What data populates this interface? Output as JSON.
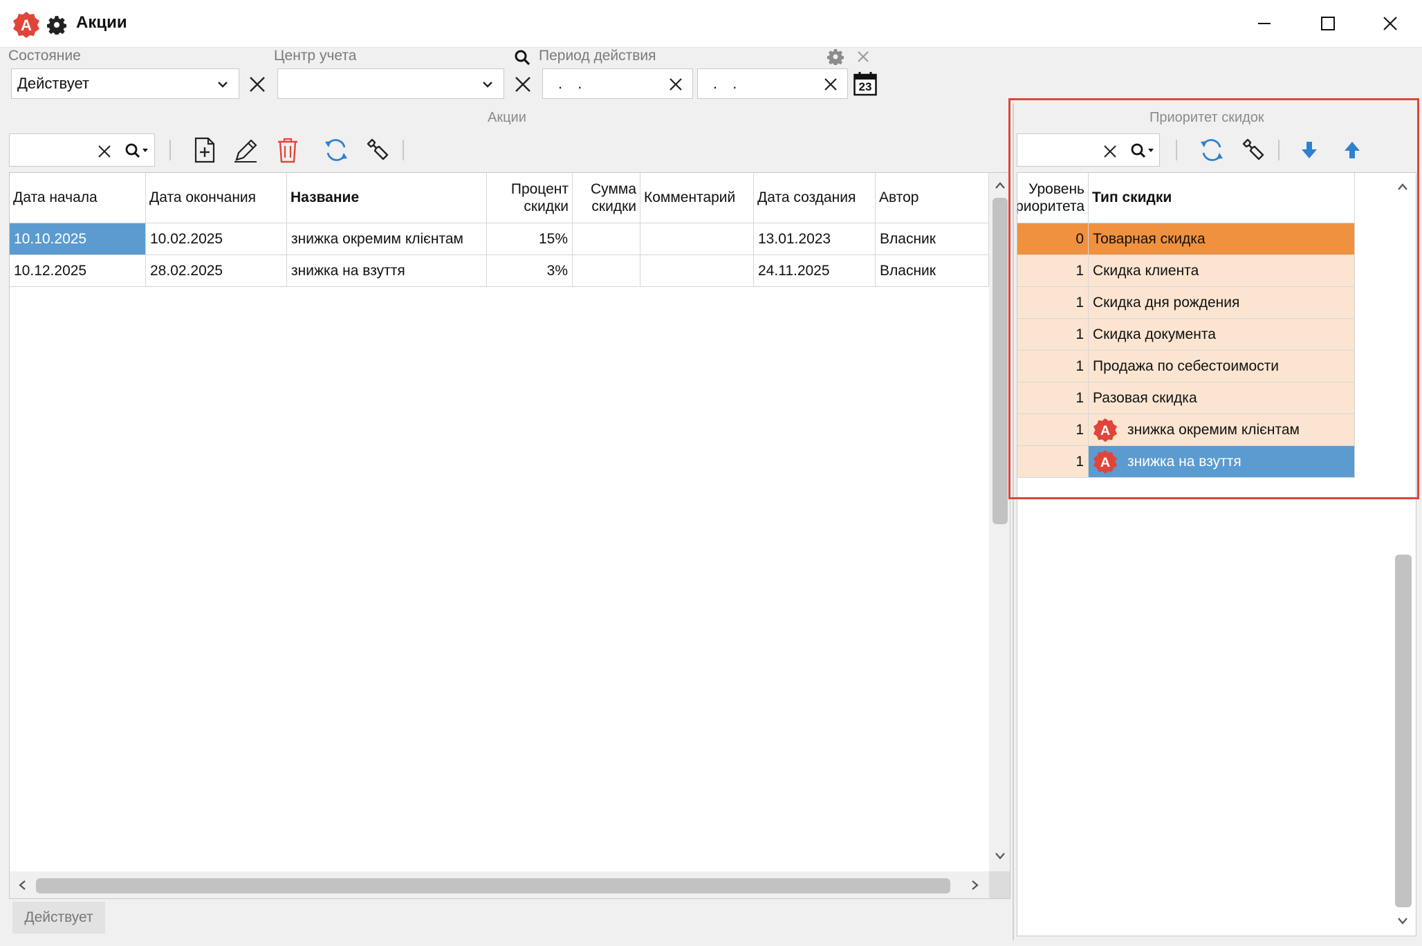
{
  "window": {
    "title": "Акции",
    "controls": [
      "minimize",
      "maximize",
      "close"
    ]
  },
  "filters": {
    "state_label": "Состояние",
    "state_value": "Действует",
    "center_label": "Центр учета",
    "center_value": "",
    "period_label": "Период действия",
    "period_from": ". .",
    "period_to": ". .",
    "calendar_day": "23"
  },
  "promotions": {
    "section_title": "Акции",
    "columns": [
      "Дата начала",
      "Дата окончания",
      "Название",
      "Процент скидки",
      "Сумма скидки",
      "Комментарий",
      "Дата создания",
      "Автор"
    ],
    "rows": [
      {
        "start": "10.10.2025",
        "end": "10.02.2025",
        "name": "знижка  окремим клієнтам",
        "percent": "15%",
        "sum": "",
        "comment": "",
        "created": "13.01.2023",
        "author": "Власник"
      },
      {
        "start": "10.12.2025",
        "end": "28.02.2025",
        "name": "знижка на взуття",
        "percent": "3%",
        "sum": "",
        "comment": "",
        "created": "24.11.2025",
        "author": "Власник"
      }
    ],
    "status_button": "Действует"
  },
  "priority": {
    "section_title": "Приоритет скидок",
    "columns": [
      "Уровень приоритета",
      "Тип скидки"
    ],
    "rows": [
      {
        "level": "0",
        "type": "Товарная скидка"
      },
      {
        "level": "1",
        "type": "Скидка клиента"
      },
      {
        "level": "1",
        "type": "Скидка дня рождения"
      },
      {
        "level": "1",
        "type": "Скидка документа"
      },
      {
        "level": "1",
        "type": "Продажа по себестоимости"
      },
      {
        "level": "1",
        "type": "Разовая скидка"
      },
      {
        "level": "1",
        "type": "знижка  окремим клієнтам"
      },
      {
        "level": "1",
        "type": "знижка на взуття"
      }
    ]
  },
  "colors": {
    "accent_red": "#e0453a",
    "selection_blue": "#5b9bd0",
    "priority_orange": "#f0913f",
    "priority_peach": "#fbe5d0",
    "icon_blue": "#2f80d0"
  }
}
